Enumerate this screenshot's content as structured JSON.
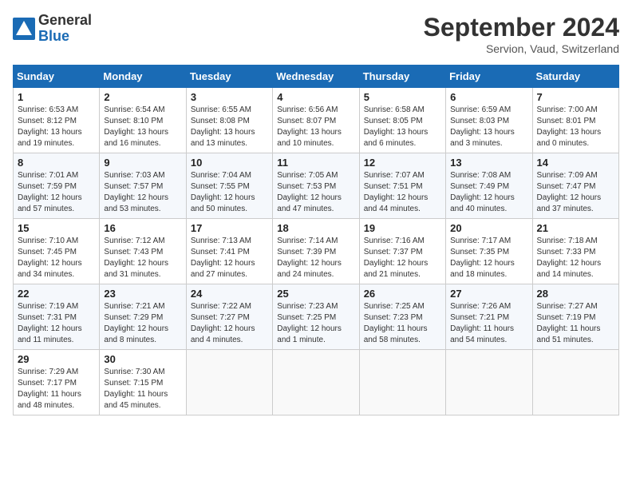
{
  "logo": {
    "general": "General",
    "blue": "Blue"
  },
  "title": {
    "month_year": "September 2024",
    "location": "Servion, Vaud, Switzerland"
  },
  "weekdays": [
    "Sunday",
    "Monday",
    "Tuesday",
    "Wednesday",
    "Thursday",
    "Friday",
    "Saturday"
  ],
  "weeks": [
    [
      {
        "day": "1",
        "sunrise": "Sunrise: 6:53 AM",
        "sunset": "Sunset: 8:12 PM",
        "daylight": "Daylight: 13 hours and 19 minutes."
      },
      {
        "day": "2",
        "sunrise": "Sunrise: 6:54 AM",
        "sunset": "Sunset: 8:10 PM",
        "daylight": "Daylight: 13 hours and 16 minutes."
      },
      {
        "day": "3",
        "sunrise": "Sunrise: 6:55 AM",
        "sunset": "Sunset: 8:08 PM",
        "daylight": "Daylight: 13 hours and 13 minutes."
      },
      {
        "day": "4",
        "sunrise": "Sunrise: 6:56 AM",
        "sunset": "Sunset: 8:07 PM",
        "daylight": "Daylight: 13 hours and 10 minutes."
      },
      {
        "day": "5",
        "sunrise": "Sunrise: 6:58 AM",
        "sunset": "Sunset: 8:05 PM",
        "daylight": "Daylight: 13 hours and 6 minutes."
      },
      {
        "day": "6",
        "sunrise": "Sunrise: 6:59 AM",
        "sunset": "Sunset: 8:03 PM",
        "daylight": "Daylight: 13 hours and 3 minutes."
      },
      {
        "day": "7",
        "sunrise": "Sunrise: 7:00 AM",
        "sunset": "Sunset: 8:01 PM",
        "daylight": "Daylight: 13 hours and 0 minutes."
      }
    ],
    [
      {
        "day": "8",
        "sunrise": "Sunrise: 7:01 AM",
        "sunset": "Sunset: 7:59 PM",
        "daylight": "Daylight: 12 hours and 57 minutes."
      },
      {
        "day": "9",
        "sunrise": "Sunrise: 7:03 AM",
        "sunset": "Sunset: 7:57 PM",
        "daylight": "Daylight: 12 hours and 53 minutes."
      },
      {
        "day": "10",
        "sunrise": "Sunrise: 7:04 AM",
        "sunset": "Sunset: 7:55 PM",
        "daylight": "Daylight: 12 hours and 50 minutes."
      },
      {
        "day": "11",
        "sunrise": "Sunrise: 7:05 AM",
        "sunset": "Sunset: 7:53 PM",
        "daylight": "Daylight: 12 hours and 47 minutes."
      },
      {
        "day": "12",
        "sunrise": "Sunrise: 7:07 AM",
        "sunset": "Sunset: 7:51 PM",
        "daylight": "Daylight: 12 hours and 44 minutes."
      },
      {
        "day": "13",
        "sunrise": "Sunrise: 7:08 AM",
        "sunset": "Sunset: 7:49 PM",
        "daylight": "Daylight: 12 hours and 40 minutes."
      },
      {
        "day": "14",
        "sunrise": "Sunrise: 7:09 AM",
        "sunset": "Sunset: 7:47 PM",
        "daylight": "Daylight: 12 hours and 37 minutes."
      }
    ],
    [
      {
        "day": "15",
        "sunrise": "Sunrise: 7:10 AM",
        "sunset": "Sunset: 7:45 PM",
        "daylight": "Daylight: 12 hours and 34 minutes."
      },
      {
        "day": "16",
        "sunrise": "Sunrise: 7:12 AM",
        "sunset": "Sunset: 7:43 PM",
        "daylight": "Daylight: 12 hours and 31 minutes."
      },
      {
        "day": "17",
        "sunrise": "Sunrise: 7:13 AM",
        "sunset": "Sunset: 7:41 PM",
        "daylight": "Daylight: 12 hours and 27 minutes."
      },
      {
        "day": "18",
        "sunrise": "Sunrise: 7:14 AM",
        "sunset": "Sunset: 7:39 PM",
        "daylight": "Daylight: 12 hours and 24 minutes."
      },
      {
        "day": "19",
        "sunrise": "Sunrise: 7:16 AM",
        "sunset": "Sunset: 7:37 PM",
        "daylight": "Daylight: 12 hours and 21 minutes."
      },
      {
        "day": "20",
        "sunrise": "Sunrise: 7:17 AM",
        "sunset": "Sunset: 7:35 PM",
        "daylight": "Daylight: 12 hours and 18 minutes."
      },
      {
        "day": "21",
        "sunrise": "Sunrise: 7:18 AM",
        "sunset": "Sunset: 7:33 PM",
        "daylight": "Daylight: 12 hours and 14 minutes."
      }
    ],
    [
      {
        "day": "22",
        "sunrise": "Sunrise: 7:19 AM",
        "sunset": "Sunset: 7:31 PM",
        "daylight": "Daylight: 12 hours and 11 minutes."
      },
      {
        "day": "23",
        "sunrise": "Sunrise: 7:21 AM",
        "sunset": "Sunset: 7:29 PM",
        "daylight": "Daylight: 12 hours and 8 minutes."
      },
      {
        "day": "24",
        "sunrise": "Sunrise: 7:22 AM",
        "sunset": "Sunset: 7:27 PM",
        "daylight": "Daylight: 12 hours and 4 minutes."
      },
      {
        "day": "25",
        "sunrise": "Sunrise: 7:23 AM",
        "sunset": "Sunset: 7:25 PM",
        "daylight": "Daylight: 12 hours and 1 minute."
      },
      {
        "day": "26",
        "sunrise": "Sunrise: 7:25 AM",
        "sunset": "Sunset: 7:23 PM",
        "daylight": "Daylight: 11 hours and 58 minutes."
      },
      {
        "day": "27",
        "sunrise": "Sunrise: 7:26 AM",
        "sunset": "Sunset: 7:21 PM",
        "daylight": "Daylight: 11 hours and 54 minutes."
      },
      {
        "day": "28",
        "sunrise": "Sunrise: 7:27 AM",
        "sunset": "Sunset: 7:19 PM",
        "daylight": "Daylight: 11 hours and 51 minutes."
      }
    ],
    [
      {
        "day": "29",
        "sunrise": "Sunrise: 7:29 AM",
        "sunset": "Sunset: 7:17 PM",
        "daylight": "Daylight: 11 hours and 48 minutes."
      },
      {
        "day": "30",
        "sunrise": "Sunrise: 7:30 AM",
        "sunset": "Sunset: 7:15 PM",
        "daylight": "Daylight: 11 hours and 45 minutes."
      },
      null,
      null,
      null,
      null,
      null
    ]
  ]
}
